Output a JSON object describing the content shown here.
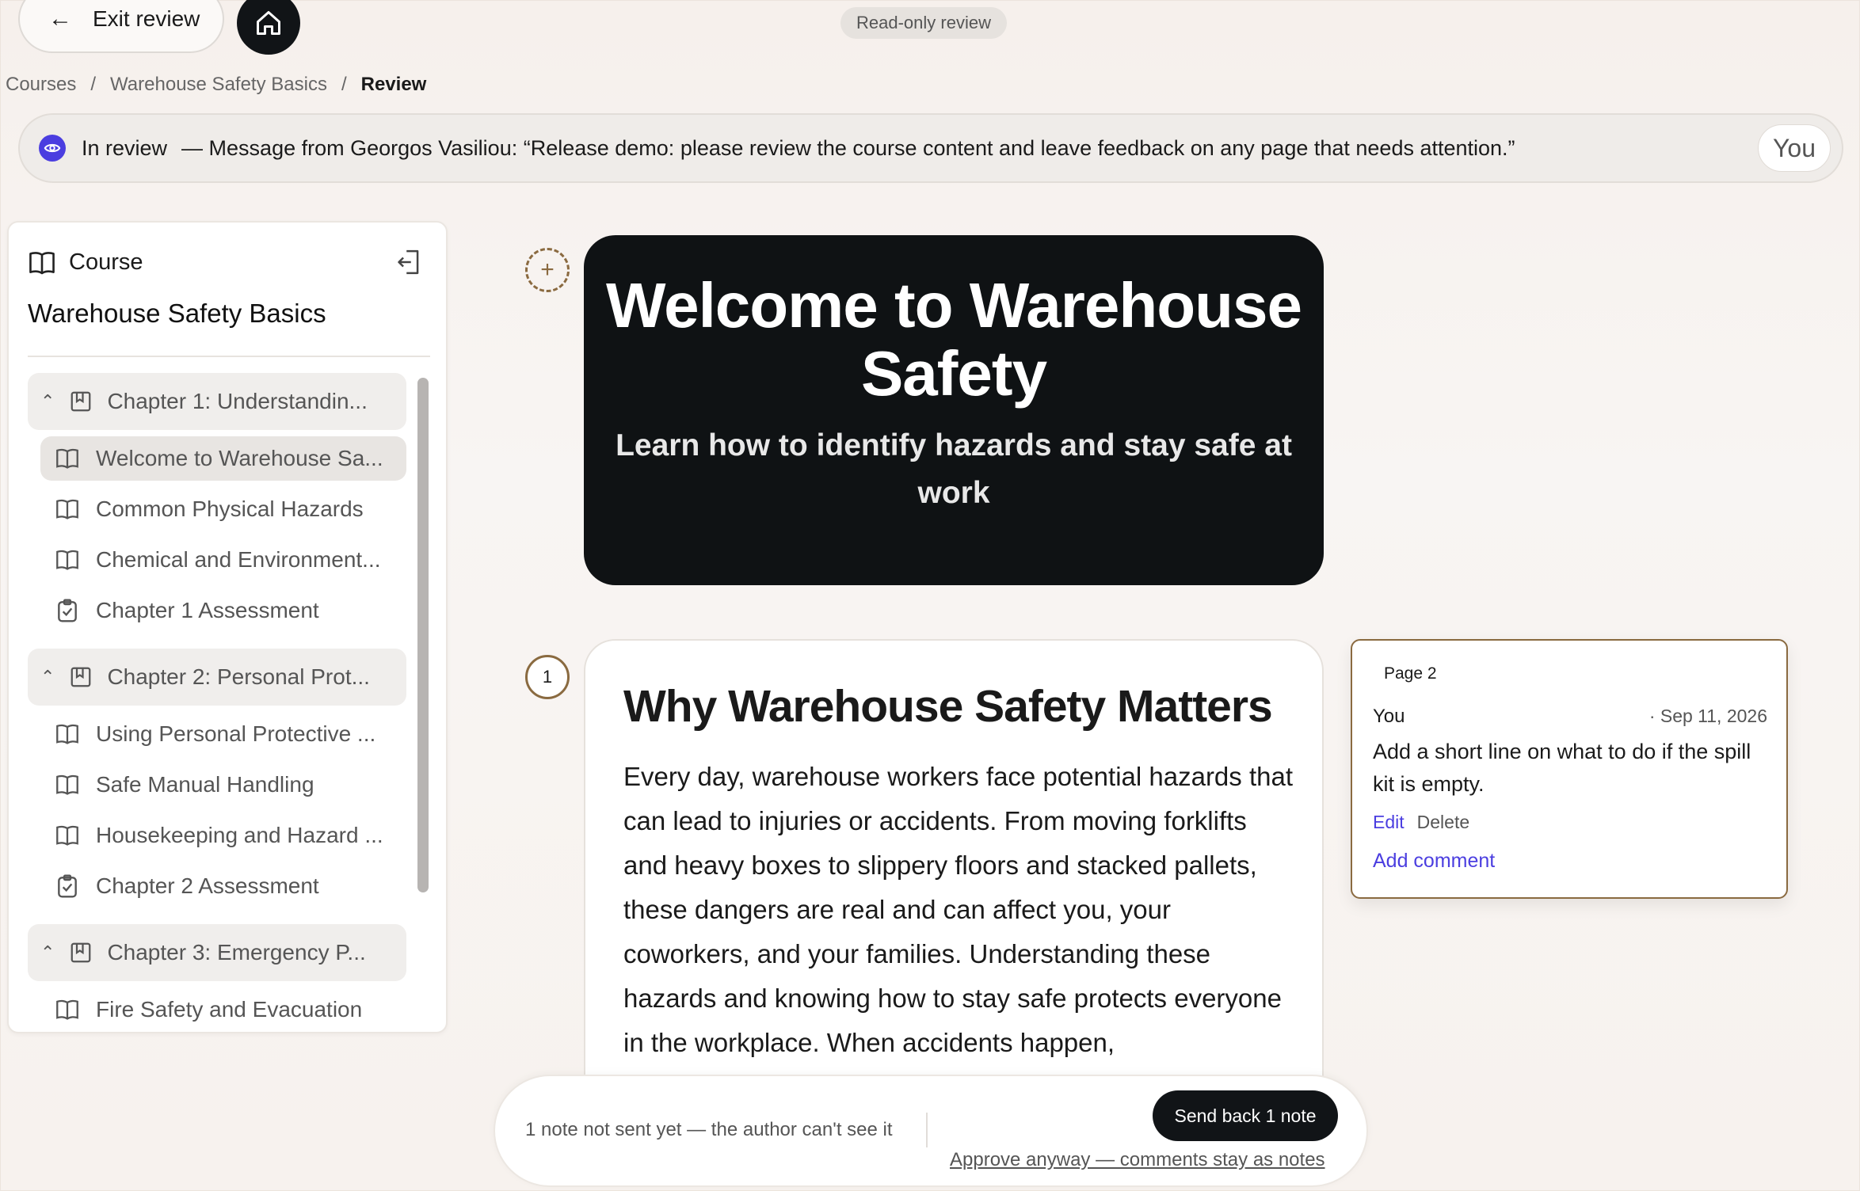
{
  "topbar": {
    "exit_label": "Exit review",
    "readonly_badge": "Read-only review"
  },
  "breadcrumb": [
    "Courses",
    "Warehouse Safety Basics",
    "Review"
  ],
  "banner": {
    "status": "In review",
    "message": "— Message from Georgos Vasiliou: “Release demo: please review the course content and leave feedback on any page that needs attention.”",
    "user_chip": "You"
  },
  "sidebar": {
    "heading": "Course",
    "course_title": "Warehouse Safety Basics",
    "items": [
      {
        "type": "chapter",
        "label": "Chapter 1: Understandin..."
      },
      {
        "type": "lesson",
        "label": "Welcome to Warehouse Sa...",
        "active": true
      },
      {
        "type": "lesson",
        "label": "Common Physical Hazards"
      },
      {
        "type": "lesson",
        "label": "Chemical and Environment..."
      },
      {
        "type": "assessment",
        "label": "Chapter 1 Assessment"
      },
      {
        "type": "chapter",
        "label": "Chapter 2: Personal Prot..."
      },
      {
        "type": "lesson",
        "label": "Using Personal Protective ..."
      },
      {
        "type": "lesson",
        "label": "Safe Manual Handling"
      },
      {
        "type": "lesson",
        "label": "Housekeeping and Hazard ..."
      },
      {
        "type": "assessment",
        "label": "Chapter 2 Assessment"
      },
      {
        "type": "chapter",
        "label": "Chapter 3: Emergency P..."
      },
      {
        "type": "lesson",
        "label": "Fire Safety and Evacuation"
      }
    ]
  },
  "hero": {
    "title": "Welcome to Warehouse Safety",
    "subtitle": "Learn how to identify hazards and stay safe at work"
  },
  "page2": {
    "number": "1",
    "title": "Why Warehouse Safety Matters",
    "body": "Every day, warehouse workers face potential hazards that can lead to injuries or accidents. From moving forklifts and heavy boxes to slippery floors and stacked pallets, these dangers are real and can affect you, your coworkers, and your families. Understanding these hazards and knowing how to stay safe protects everyone in the workplace. When accidents happen,"
  },
  "comment": {
    "page": "Page 2",
    "author": "You",
    "date": "· Sep 11, 2026",
    "text": "Add a short line on what to do if the spill kit is empty.",
    "edit": "Edit",
    "delete": "Delete",
    "add": "Add comment"
  },
  "bottom": {
    "note": "1 note not sent yet — the author can't see it",
    "send": "Send back 1 note",
    "approve": "Approve anyway — comments stay as notes"
  }
}
